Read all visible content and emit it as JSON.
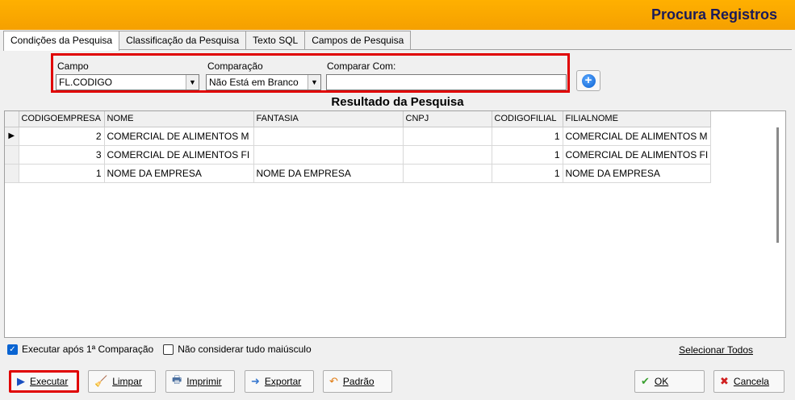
{
  "window": {
    "title": "Procura Registros"
  },
  "tabs": [
    {
      "label": "Condições da Pesquisa"
    },
    {
      "label": "Classificação da Pesquisa"
    },
    {
      "label": "Texto SQL"
    },
    {
      "label": "Campos de Pesquisa"
    }
  ],
  "conditions": {
    "campo_label": "Campo",
    "campo_value": "FL.CODIGO",
    "comparacao_label": "Comparação",
    "comparacao_value": "Não Está em Branco",
    "comparar_com_label": "Comparar Com:",
    "comparar_com_value": ""
  },
  "results": {
    "title": "Resultado da Pesquisa",
    "columns": [
      "CODIGOEMPRESA",
      "NOME",
      "FANTASIA",
      "CNPJ",
      "CODIGOFILIAL",
      "FILIALNOME"
    ],
    "rows": [
      {
        "codigoempresa": "2",
        "nome": "COMERCIAL DE ALIMENTOS M",
        "fantasia": "",
        "cnpj": "",
        "codigofilial": "1",
        "filialnome": "COMERCIAL DE ALIMENTOS M"
      },
      {
        "codigoempresa": "3",
        "nome": "COMERCIAL DE ALIMENTOS FI",
        "fantasia": "",
        "cnpj": "",
        "codigofilial": "1",
        "filialnome": "COMERCIAL DE ALIMENTOS FI"
      },
      {
        "codigoempresa": "1",
        "nome": "NOME DA EMPRESA",
        "fantasia": "NOME DA EMPRESA",
        "cnpj": "",
        "codigofilial": "1",
        "filialnome": "NOME DA EMPRESA"
      }
    ],
    "current_row_marker": "▶"
  },
  "options": {
    "executar_apos_label": "Executar após 1ª Comparação",
    "executar_apos_checked": true,
    "nao_maiusculo_label": "Não considerar tudo maiúsculo",
    "nao_maiusculo_checked": false,
    "selecionar_todos": "Selecionar Todos"
  },
  "buttons": {
    "executar": "Executar",
    "limpar": "Limpar",
    "imprimir": "Imprimir",
    "exportar": "Exportar",
    "padrao": "Padrão",
    "ok": "OK",
    "cancela": "Cancela"
  },
  "icons": {
    "add": "plus-circle-icon",
    "dropdown": "chevron-down-icon"
  },
  "colors": {
    "titlebar": "#f5a000",
    "highlight": "#e00000",
    "accent_blue": "#0a64d2"
  }
}
